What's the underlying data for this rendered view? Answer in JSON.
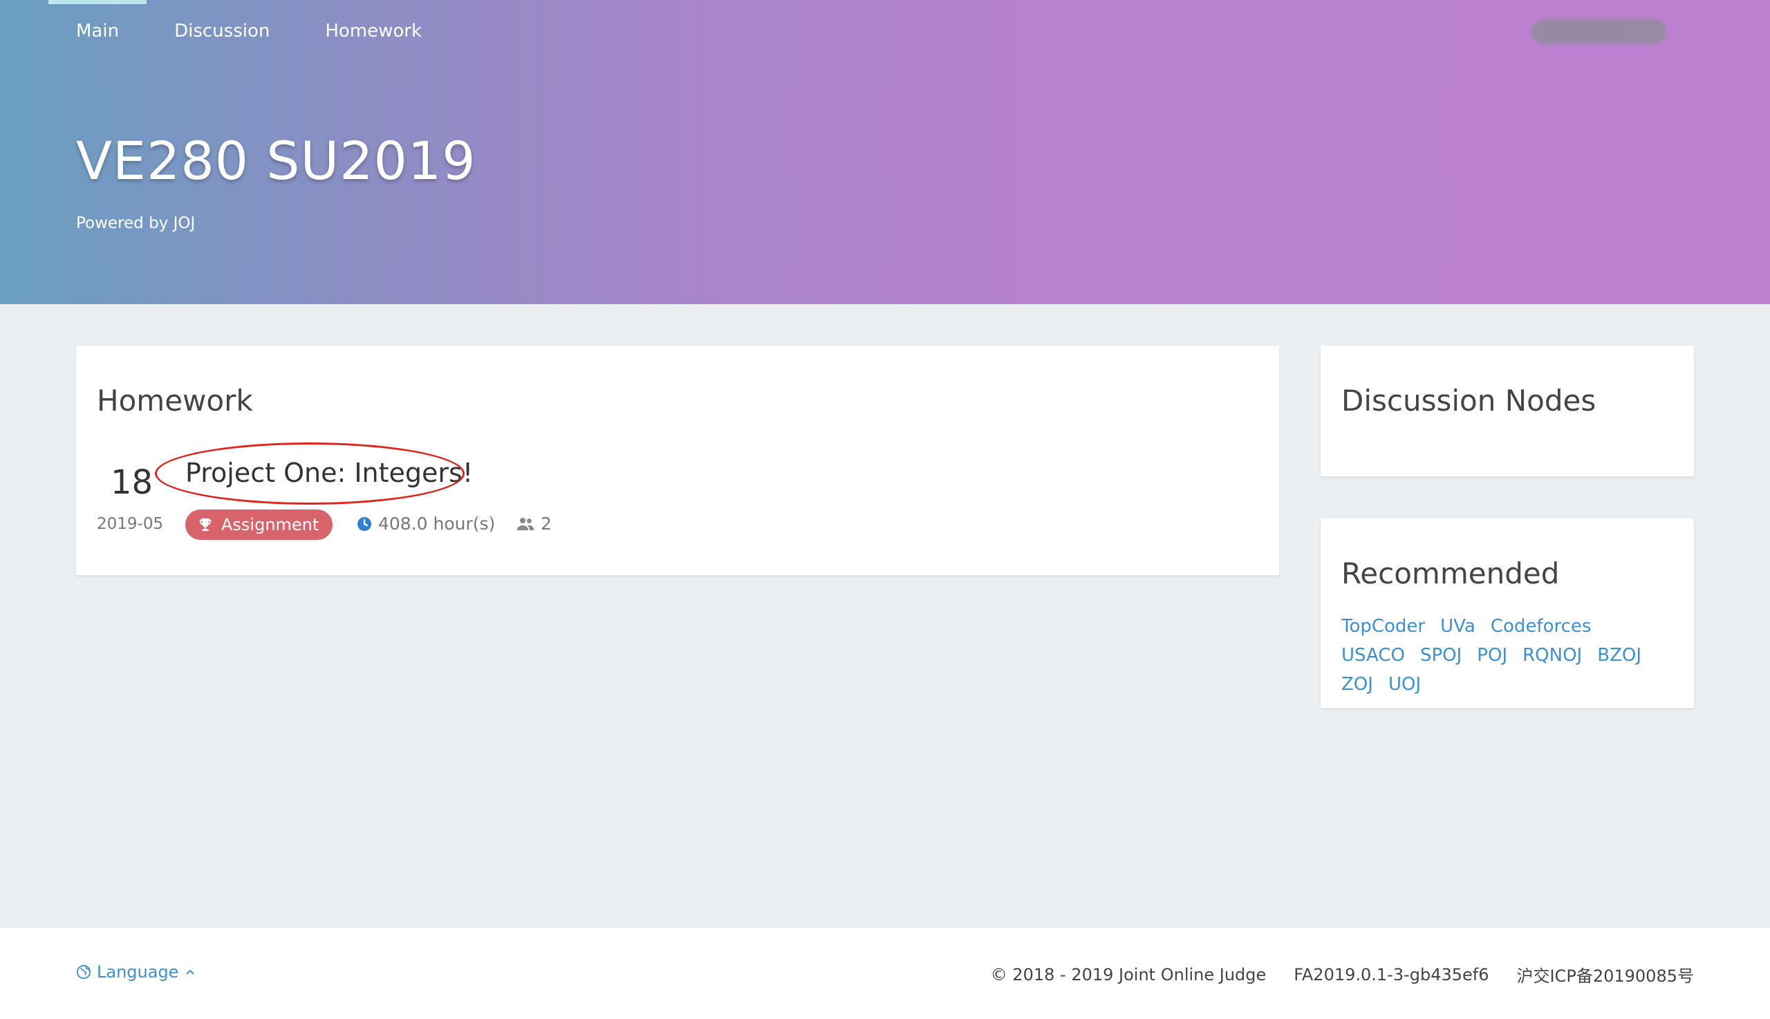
{
  "nav": {
    "items": [
      {
        "label": "Main",
        "active": true
      },
      {
        "label": "Discussion",
        "active": false
      },
      {
        "label": "Homework",
        "active": false
      }
    ]
  },
  "hero": {
    "title": "VE280 SU2019",
    "subtitle": "Powered by JOJ"
  },
  "homework": {
    "title": "Homework",
    "entry": {
      "day": "18",
      "month": "2019-05",
      "title": "Project One: Integers!",
      "badge": "Assignment",
      "duration": "408.0 hour(s)",
      "participants": "2"
    }
  },
  "discussion_nodes": {
    "title": "Discussion Nodes"
  },
  "recommended": {
    "title": "Recommended",
    "links": [
      "TopCoder",
      "UVa",
      "Codeforces",
      "USACO",
      "SPOJ",
      "POJ",
      "RQNOJ",
      "BZOJ",
      "ZOJ",
      "UOJ"
    ]
  },
  "footer": {
    "language": "Language",
    "copyright": "© 2018 - 2019 Joint Online Judge",
    "version": "FA2019.0.1-3-gb435ef6",
    "icp": "沪交ICP备20190085号"
  },
  "colors": {
    "accent_link": "#3c90d4",
    "badge": "#d9636a",
    "highlight_circle": "#e0231c",
    "page_bg": "#ebeff2"
  },
  "icons": {
    "badge": "trophy-icon",
    "duration": "clock-icon",
    "participants": "people-icon",
    "language": "globe-icon",
    "language_toggle": "chevron-up-icon"
  }
}
